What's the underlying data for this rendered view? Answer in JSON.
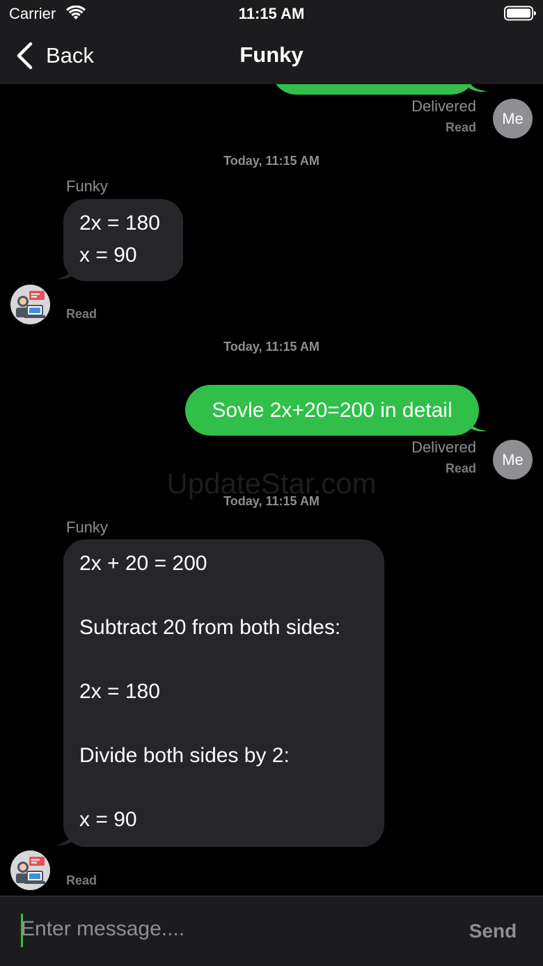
{
  "status_bar": {
    "carrier": "Carrier",
    "time": "11:15 AM"
  },
  "nav": {
    "back_label": "Back",
    "title": "Funky"
  },
  "messages": {
    "m0": {
      "delivered": "Delivered",
      "read": "Read",
      "avatar": "Me"
    },
    "m1": {
      "timestamp": "Today, 11:15 AM",
      "sender": "Funky",
      "lines": [
        "2x = 180",
        "x = 90"
      ],
      "read": "Read"
    },
    "m2": {
      "timestamp": "Today, 11:15 AM",
      "text": "Sovle 2x+20=200 in detail",
      "delivered": "Delivered",
      "read": "Read",
      "avatar": "Me"
    },
    "m3": {
      "timestamp": "Today, 11:15 AM",
      "sender": "Funky",
      "lines": [
        "2x + 20 = 200",
        "Subtract 20 from both sides:",
        "2x = 180",
        "Divide both sides by 2:",
        "x = 90"
      ],
      "read": "Read"
    }
  },
  "watermark": "UpdateStar.com",
  "composer": {
    "placeholder": "Enter message....",
    "value": "",
    "send_label": "Send"
  },
  "colors": {
    "outgoing_bubble": "#30c04a",
    "incoming_bubble": "#26262a",
    "background": "#000000",
    "bar": "#1c1c1e",
    "secondary_text": "#8e8e93"
  },
  "icons": {
    "wifi": "wifi-icon",
    "battery": "battery-icon",
    "back": "chevron-left-icon",
    "bot_avatar": "robot-avatar-icon"
  }
}
